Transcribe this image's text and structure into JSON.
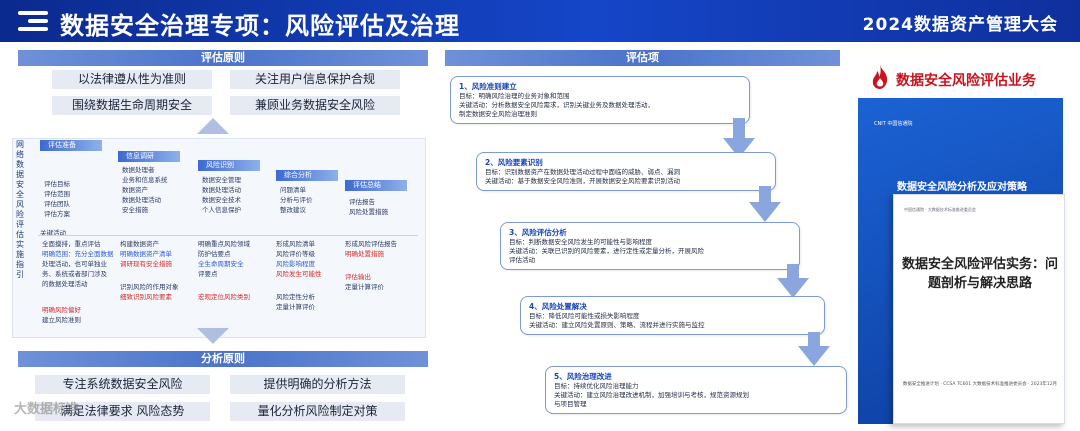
{
  "header": {
    "title": "数据安全治理专项：风险评估及治理",
    "event": "2024数据资产管理大会"
  },
  "eval_principles": {
    "title": "评估原则",
    "items": [
      "以法律遵从性为准则",
      "关注用户信息保护合规",
      "围绕数据生命周期安全",
      "兼顾业务数据安全风险"
    ]
  },
  "framework": {
    "side_label": "网络数据安全风险评估实施指引",
    "columns": [
      {
        "head": "评估准备",
        "items": [
          "评估目标",
          "评估范围",
          "评估团队",
          "评估方案"
        ]
      },
      {
        "head": "信息调研",
        "items": [
          "数据处理者",
          "业务和信息系统",
          "数据资产",
          "数据处理活动",
          "安全措施"
        ]
      },
      {
        "head": "风险识别",
        "items": [
          "数据安全管理",
          "数据处理活动",
          "数据安全技术",
          "个人信息保护"
        ]
      },
      {
        "head": "综合分析",
        "items": [
          "问题清单",
          "分析与评价",
          "整改建议"
        ]
      },
      {
        "head": "评估总结",
        "items": [
          "评估报告",
          "风险处置措施"
        ]
      }
    ],
    "key_title": "关键活动",
    "key_cols": [
      [
        "全面摸排，重点评估",
        "明确范围：充分全面数据",
        "处理活动，也可单独业",
        "务、系统或者部门涉及",
        "的数据处理活动"
      ],
      [
        "构建数据资产",
        "明确数据资产清单",
        "调研现有安全措施"
      ],
      [
        "明确重点风险领域",
        "防护估要点",
        "全生命周期安全",
        "评要点"
      ],
      [
        "形成风险清单",
        "风险评价等级",
        "风险影响程度",
        "风险发生可能性"
      ],
      [
        "形成风险评估报告",
        "明确处置措施"
      ]
    ],
    "key_extra": [
      [
        "明确风险偏好",
        "建立风险准则"
      ],
      [
        "识别风险的作用对象",
        "细致识别风险要素"
      ],
      [
        "宏观定位风险类别"
      ],
      [
        "风险定性分析",
        "定量计算评价"
      ],
      [
        "评估输出",
        "定量计算评价"
      ]
    ]
  },
  "analysis_principles": {
    "title": "分析原则",
    "items": [
      "专注系统数据安全风险",
      "提供明确的分析方法",
      "满足法律要求 风险态势",
      "量化分析风险制定对策"
    ]
  },
  "eval_items": {
    "title": "评估项",
    "steps": [
      {
        "title": "1、风险准则建立",
        "lines": [
          "目标：明确风险治理的业务对象和范围",
          "关键活动：分析数据安全风险需求，识别关键业务及数据处理活动，",
          "制定数据安全风险治理准则"
        ]
      },
      {
        "title": "2、风险要素识别",
        "lines": [
          "目标：识别数据资产在数据处理活动过程中面临的威胁、弱点、漏洞",
          "关键活动：基于数据安全风险准则，开展数据安全风险要素识别活动"
        ]
      },
      {
        "title": "3、风险评估分析",
        "lines": [
          "目标：判断数据安全风险发生的可能性与影响程度",
          "关键活动：关联已识别的风险要素，进行定性或定量分析，开展风险",
          "评估活动"
        ]
      },
      {
        "title": "4、风险处置解决",
        "lines": [
          "目标：降低风险可能性或损失影响程度",
          "关键活动：建立风险处置原则、策略、流程并进行实施与监控"
        ]
      },
      {
        "title": "5、风险治理改进",
        "lines": [
          "目标：持续优化风险治理能力",
          "关键活动：建立风险治理改进机制，加强培训与考核，规范资源规划",
          "与项目管理"
        ]
      }
    ]
  },
  "promo": {
    "title": "数据安全风险评估业务",
    "back_cover_title": "数据安全风险分析及应对策略",
    "back_logos": "CNIT 中国信通院",
    "front_title": "数据安全风险评估实务：问题剖析与解决思路",
    "front_logos": "中国信通院 · 大数据技术标准推进委员会",
    "front_org": "数据安全推进计划 · CCSA TC601 大数据技术标准推进委员会 · 2023年12月"
  },
  "watermark": "大数据标准"
}
